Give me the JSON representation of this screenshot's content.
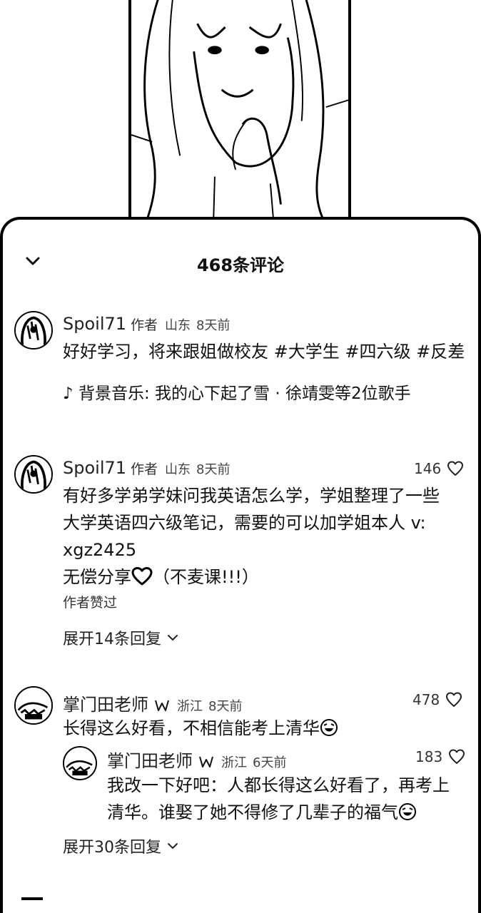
{
  "header": {
    "title": "468条评论"
  },
  "comments": [
    {
      "username": "Spoil71",
      "author_tag": "作者",
      "region": "山东",
      "time": "8天前",
      "text": "好好学习，将来跟姐做校友 #大学生 #四六级 #反差",
      "music": "♪ 背景音乐: 我的心下起了雪 · 徐靖雯等2位歌手"
    },
    {
      "username": "Spoil71",
      "author_tag": "作者",
      "region": "山东",
      "time": "8天前",
      "likes": "146",
      "lines": [
        "有好多学弟学妹问我英语怎么学，学姐整理了一些",
        "大学英语四六级笔记，需要的可以加学姐本人 v:",
        "xgz2425"
      ],
      "line4_prefix": "无偿分享",
      "line4_suffix": "（不麦课!!!）",
      "liked_note": "作者赞过",
      "expand": "展开14条回复"
    },
    {
      "username": "掌门田老师",
      "region": "浙江",
      "time": "8天前",
      "likes": "478",
      "text": "长得这么好看，不相信能考上清华",
      "expand": "展开30条回复",
      "reply": {
        "username": "掌门田老师",
        "region": "浙江",
        "time": "6天前",
        "likes": "183",
        "line1": "我改一下好吧：人都长得这么好看了，再考上",
        "line2": "清华。谁娶了她不得修了几辈子的福气"
      }
    }
  ],
  "icons": {
    "collapse": "chevron-down-icon",
    "like": "heart-icon",
    "verify": "verified-badge-icon",
    "emoji": "laugh-cry-emoji-icon"
  }
}
